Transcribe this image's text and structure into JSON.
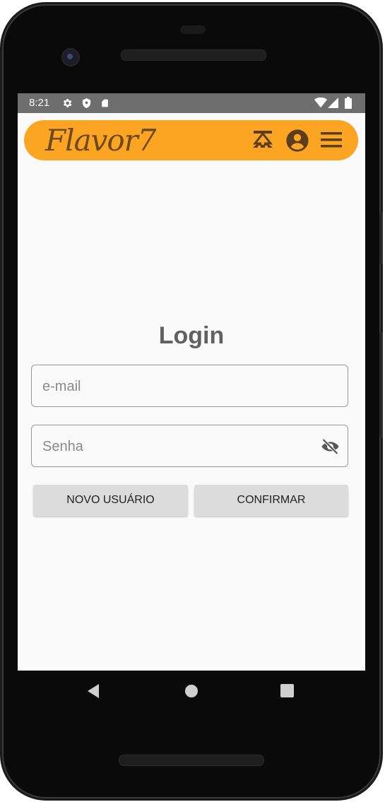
{
  "status_bar": {
    "time": "8:21",
    "left_icons": [
      "settings-icon",
      "shield-icon",
      "sd-card-icon"
    ],
    "right_icons": [
      "wifi-icon",
      "signal-icon",
      "battery-icon"
    ]
  },
  "app_bar": {
    "logo": "Flavor7",
    "background_color": "#fca523",
    "actions": [
      "food-service-icon",
      "account-circle-icon",
      "menu-icon"
    ]
  },
  "login": {
    "title": "Login",
    "email_placeholder": "e-mail",
    "email_value": "",
    "password_placeholder": "Senha",
    "password_value": "",
    "password_visibility_icon": "eye-off-icon",
    "new_user_button": "NOVO USUÁRIO",
    "confirm_button": "CONFIRMAR"
  },
  "nav_bar": {
    "buttons": [
      "back-icon",
      "home-icon",
      "recents-icon"
    ]
  }
}
